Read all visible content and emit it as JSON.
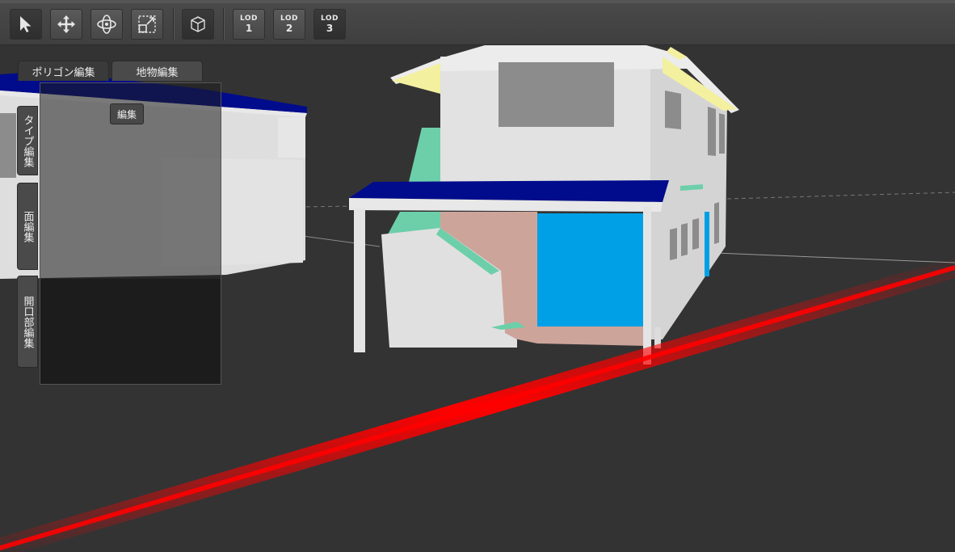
{
  "toolbar": {
    "tools": [
      {
        "name": "select-tool",
        "icon": "arrow-cursor-icon",
        "active": true
      },
      {
        "name": "move-tool",
        "icon": "move-arrows-icon",
        "active": false
      },
      {
        "name": "rotate-tool",
        "icon": "orbit-rotate-icon",
        "active": false
      },
      {
        "name": "scale-tool",
        "icon": "scale-box-icon",
        "active": false
      }
    ],
    "view_tool": {
      "icon": "cube-view-icon"
    },
    "lod_buttons": [
      {
        "top": "LOD",
        "num": "1"
      },
      {
        "top": "LOD",
        "num": "2"
      },
      {
        "top": "LOD",
        "num": "3"
      }
    ]
  },
  "panel": {
    "tabs": [
      "ポリゴン編集",
      "地物編集"
    ],
    "active_tab": "ポリゴン編集",
    "side_tabs": [
      "タイプ編集",
      "面編集",
      "開口部編集"
    ],
    "edit_button": "編集"
  },
  "colors": {
    "roof": "#000c8c",
    "wall": "#dedede",
    "window": "#8c8c8c",
    "door": "#00a0e6",
    "pink_wall": "#cda49a",
    "green_roof": "#6ccfaa",
    "axis": "#ff0000",
    "background": "#333333"
  }
}
